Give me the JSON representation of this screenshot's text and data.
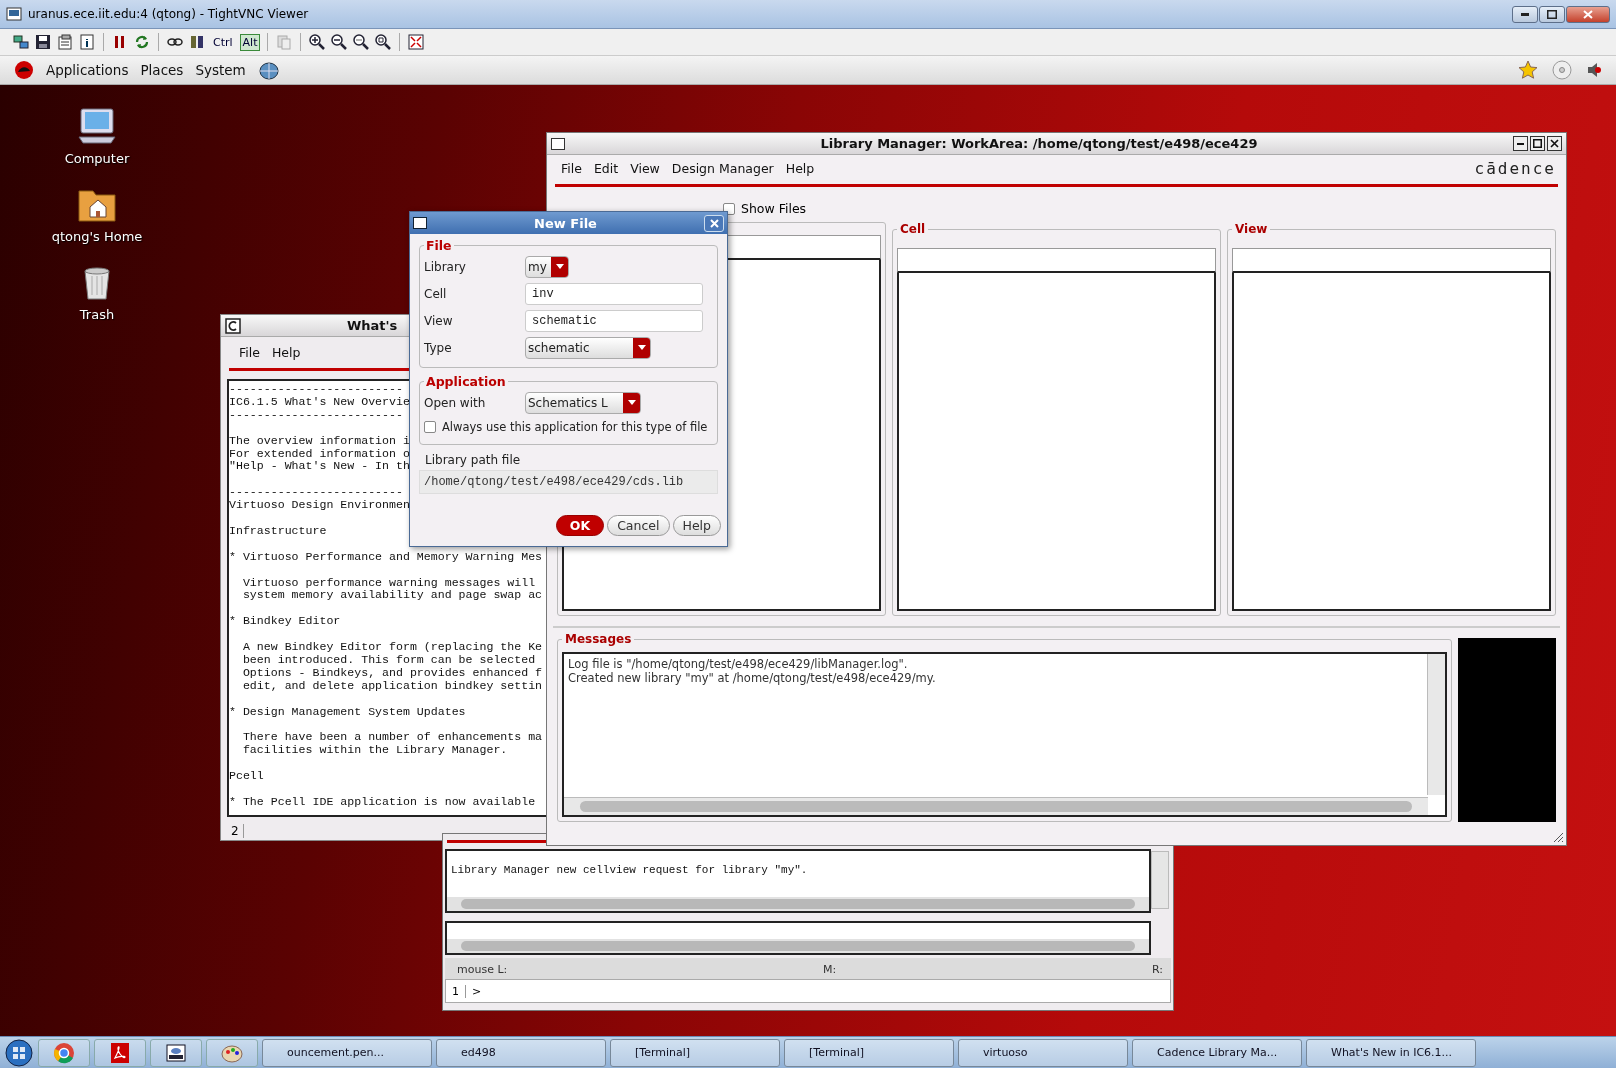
{
  "vnc_window": {
    "title": "uranus.ece.iit.edu:4 (qtong) - TightVNC Viewer",
    "toolbar_keys": [
      {
        "label": "Ctrl",
        "selected": false
      },
      {
        "label": "Alt",
        "selected": true
      }
    ]
  },
  "top_panel": {
    "menus": [
      "Applications",
      "Places",
      "System"
    ]
  },
  "desktop_icons": [
    {
      "label": "Computer",
      "kind": "computer"
    },
    {
      "label": "qtong's Home",
      "kind": "home"
    },
    {
      "label": "Trash",
      "kind": "trash"
    }
  ],
  "whats_new": {
    "title": "What's",
    "menus": [
      "File",
      "Help"
    ],
    "blocks": [
      [
        "-------------------------",
        "IC6.1.5 What's New Overvie",
        "-------------------------"
      ],
      [
        "The overview information i",
        "For extended information o",
        "\"Help - What's New - In th"
      ],
      [
        "-------------------------",
        "Virtuoso Design Environmen"
      ],
      [
        "Infrastructure"
      ],
      [
        "* Virtuoso Performance and Memory Warning Mes"
      ],
      [
        "  Virtuoso performance warning messages will",
        "  system memory availability and page swap ac"
      ],
      [
        "* Bindkey Editor"
      ],
      [
        "  A new Bindkey Editor form (replacing the Ke",
        "  been introduced. This form can be selected",
        "  Options - Bindkeys, and provides enhanced f",
        "  edit, and delete application bindkey settin"
      ],
      [
        "* Design Management System Updates"
      ],
      [
        "  There have been a number of enhancements ma",
        "  facilities within the Library Manager."
      ],
      [
        "Pcell"
      ],
      [
        "* The Pcell IDE application is now available"
      ]
    ],
    "status": "2"
  },
  "library_manager": {
    "title": "Library Manager: WorkArea: /home/qtong/test/e498/ece429",
    "menus": [
      "File",
      "Edit",
      "View",
      "Design Manager",
      "Help"
    ],
    "logo": "cādence",
    "show_files": {
      "label": "Show Files",
      "checked": false
    },
    "panes": [
      "Cell",
      "View"
    ],
    "messages_title": "Messages",
    "messages": [
      "Log file is \"/home/qtong/test/e498/ece429/libManager.log\".",
      "Created new library \"my\" at /home/qtong/test/e498/ece429/my."
    ]
  },
  "new_file": {
    "title": "New File",
    "file_group": "File",
    "fields": [
      {
        "kind": "dropdown",
        "label": "Library",
        "value": "my"
      },
      {
        "kind": "text",
        "label": "Cell",
        "value": "inv"
      },
      {
        "kind": "text",
        "label": "View",
        "value": "schematic"
      },
      {
        "kind": "dropdown",
        "label": "Type",
        "value": "schematic"
      }
    ],
    "application_group": "Application",
    "open_with": {
      "label": "Open with",
      "value": "Schematics L"
    },
    "always_use": {
      "label": "Always use this application for this type of file",
      "checked": false
    },
    "path_label": "Library path file",
    "path": "/home/qtong/test/e498/ece429/cds.lib",
    "buttons": [
      {
        "label": "OK",
        "kind": "primary"
      },
      {
        "label": "Cancel",
        "kind": "normal"
      },
      {
        "label": "Help",
        "kind": "normal"
      }
    ]
  },
  "ciw": {
    "output": "Library Manager new cellview request for library \"my\".",
    "mouse_l": "mouse L:",
    "mouse_m": "M:",
    "mouse_r": "R:",
    "line_number": "1",
    "prompt": ">"
  },
  "taskbar": {
    "items": [
      "ouncement.pen...",
      "ed498",
      "[Terminal]",
      "[Terminal]",
      "virtuoso",
      "Cadence Library Ma...",
      "What's New in IC6.1..."
    ]
  }
}
